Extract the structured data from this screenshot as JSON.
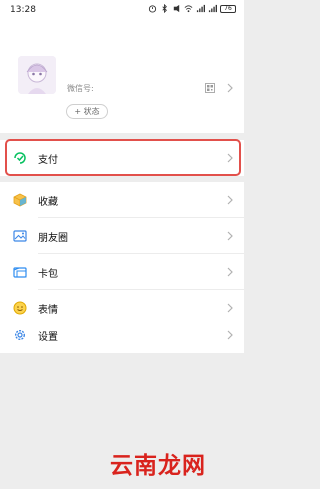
{
  "status_bar": {
    "time": "13:28",
    "battery": "76"
  },
  "profile": {
    "wechat_id_label": "微信号:",
    "status_button_label": "+ 状态"
  },
  "menu": {
    "pay": "支付",
    "favorites": "收藏",
    "moments": "朋友圈",
    "cards": "卡包",
    "stickers": "表情",
    "settings": "设置"
  },
  "watermark": "云南龙网",
  "colors": {
    "highlight": "#e2504b",
    "watermark": "#d9231d",
    "pay_icon": "#07c160",
    "favorites_icon": "#f4a623",
    "moments_icon": "#3b86e6",
    "cards_icon": "#2d8cf0",
    "stickers_icon": "#f5b800",
    "settings_icon": "#3b86e6"
  }
}
